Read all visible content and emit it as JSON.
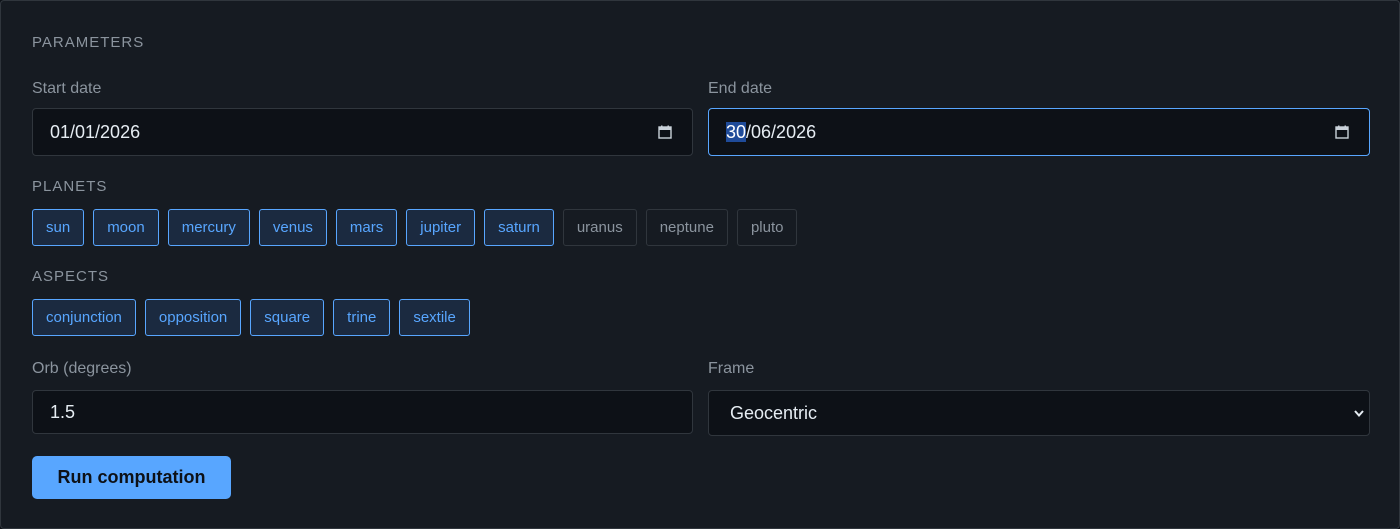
{
  "parameters": {
    "title": "PARAMETERS",
    "start_date": {
      "label": "Start date",
      "value": "01/01/2026"
    },
    "end_date": {
      "label": "End date",
      "day": "30",
      "rest": "/06/2026"
    }
  },
  "planets": {
    "title": "PLANETS",
    "items": [
      {
        "label": "sun",
        "selected": true
      },
      {
        "label": "moon",
        "selected": true
      },
      {
        "label": "mercury",
        "selected": true
      },
      {
        "label": "venus",
        "selected": true
      },
      {
        "label": "mars",
        "selected": true
      },
      {
        "label": "jupiter",
        "selected": true
      },
      {
        "label": "saturn",
        "selected": true
      },
      {
        "label": "uranus",
        "selected": false
      },
      {
        "label": "neptune",
        "selected": false
      },
      {
        "label": "pluto",
        "selected": false
      }
    ]
  },
  "aspects": {
    "title": "ASPECTS",
    "items": [
      {
        "label": "conjunction",
        "selected": true
      },
      {
        "label": "opposition",
        "selected": true
      },
      {
        "label": "square",
        "selected": true
      },
      {
        "label": "trine",
        "selected": true
      },
      {
        "label": "sextile",
        "selected": true
      }
    ]
  },
  "orb": {
    "label": "Orb (degrees)",
    "value": "1.5"
  },
  "frame": {
    "label": "Frame",
    "selected": "Geocentric"
  },
  "run_button": {
    "label": "Run computation"
  },
  "colors": {
    "accent": "#58a6ff",
    "background": "#161b22",
    "input_background": "#0d1117"
  },
  "icons": {
    "calendar": "calendar-icon",
    "chevron": "chevron-down-icon"
  }
}
